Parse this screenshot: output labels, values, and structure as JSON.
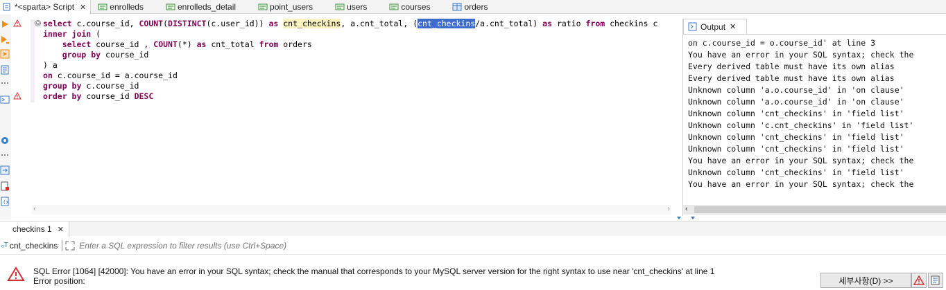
{
  "tabs": [
    {
      "label": "*<sparta> Script",
      "icon": "script-icon",
      "active": true,
      "closable": true
    },
    {
      "label": "enrolleds",
      "icon": "table-view-icon"
    },
    {
      "label": "enrolleds_detail",
      "icon": "table-view-icon"
    },
    {
      "label": "point_users",
      "icon": "table-view-icon"
    },
    {
      "label": "users",
      "icon": "table-view-icon"
    },
    {
      "label": "courses",
      "icon": "table-view-icon"
    },
    {
      "label": "orders",
      "icon": "table-grid-icon"
    }
  ],
  "tab_close_glyph": "✕",
  "editor": {
    "fold_glyph": "⊖",
    "line1": {
      "a": "select",
      "b": " c.course_id, ",
      "c": "COUNT",
      "d": "(",
      "e": "DISTINCT",
      "f": "(c.user_id)) ",
      "g": "as",
      "h": " ",
      "i": "cnt_checkins",
      "j": ", a.cnt_total, (",
      "k": "cnt_checkins",
      "l": "/a.cnt_total) ",
      "m": "as",
      "n": " ratio ",
      "o": "from",
      "p": " checkins c"
    },
    "line2": {
      "a": "inner join",
      "b": " ("
    },
    "line3": {
      "indent": "    ",
      "a": "select",
      "b": " course_id , ",
      "c": "COUNT",
      "d": "(*) ",
      "e": "as",
      "f": " cnt_total ",
      "g": "from",
      "h": " orders"
    },
    "line4": {
      "indent": "    ",
      "a": "group by",
      "b": " course_id"
    },
    "line5": {
      "a": ") a"
    },
    "line6": {
      "a": "on",
      "b": " c.course_id = a.course_id"
    },
    "line7": {
      "a": "group by",
      "b": " c.course_id"
    },
    "line8": {
      "a": "order by",
      "b": " course_id ",
      "c": "DESC"
    }
  },
  "output": {
    "tab_label": "Output",
    "lines": [
      "on c.course_id = o.course_id' at line 3",
      "You have an error in your SQL syntax; check the",
      "Every derived table must have its own alias",
      "Every derived table must have its own alias",
      "Unknown column 'a.o.course_id' in 'on clause'",
      "Unknown column 'a.o.course_id' in 'on clause'",
      "Unknown column 'cnt_checkins' in 'field list'",
      "Unknown column 'c.cnt_checkins' in 'field list'",
      "Unknown column 'cnt_checkins' in 'field list'",
      "Unknown column 'cnt_checkins' in 'field list'",
      "You have an error in your SQL syntax; check the",
      "Unknown column 'cnt_checkins' in 'field list'",
      "You have an error in your SQL syntax; check the"
    ]
  },
  "results": {
    "tab_label": "checkins 1",
    "table_name": "cnt_checkins",
    "filter_placeholder": "Enter a SQL expression to filter results (use Ctrl+Space)",
    "error_line1": "SQL Error [1064] [42000]: You have an error in your SQL syntax; check the manual that corresponds to your MySQL server version for the right syntax to use near 'cnt_checkins' at line 1",
    "error_line2": "Error position:",
    "details_button": "세부사항(D) >>"
  },
  "colors": {
    "keyword": "#7f0055",
    "selection": "#3b6ccd",
    "occurrence_highlight": "#fbf2c0",
    "error_red": "#d32f2f"
  }
}
